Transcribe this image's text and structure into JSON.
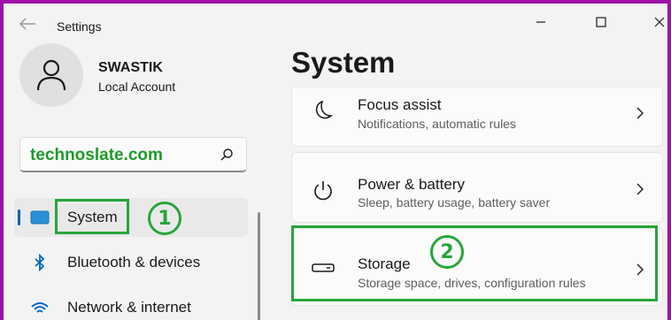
{
  "window": {
    "title": "Settings"
  },
  "user": {
    "name": "SWASTIK",
    "account_type": "Local Account"
  },
  "search": {
    "value": "technoslate.com"
  },
  "nav": {
    "items": [
      {
        "label": "System",
        "icon": "monitor-icon",
        "selected": true
      },
      {
        "label": "Bluetooth & devices",
        "icon": "bluetooth-icon",
        "selected": false
      },
      {
        "label": "Network & internet",
        "icon": "wifi-icon",
        "selected": false
      }
    ]
  },
  "page": {
    "title": "System"
  },
  "settings": [
    {
      "title": "Focus assist",
      "subtitle": "Notifications, automatic rules",
      "icon": "moon-icon"
    },
    {
      "title": "Power & battery",
      "subtitle": "Sleep, battery usage, battery saver",
      "icon": "power-icon"
    },
    {
      "title": "Storage",
      "subtitle": "Storage space, drives, configuration rules",
      "icon": "storage-icon"
    }
  ],
  "annotations": {
    "step1": "1",
    "step2": "2",
    "color": "#27a53a"
  },
  "colors": {
    "frame": "#a00fa8",
    "accent": "#005fb8",
    "window_bg": "#f3f3f3"
  }
}
